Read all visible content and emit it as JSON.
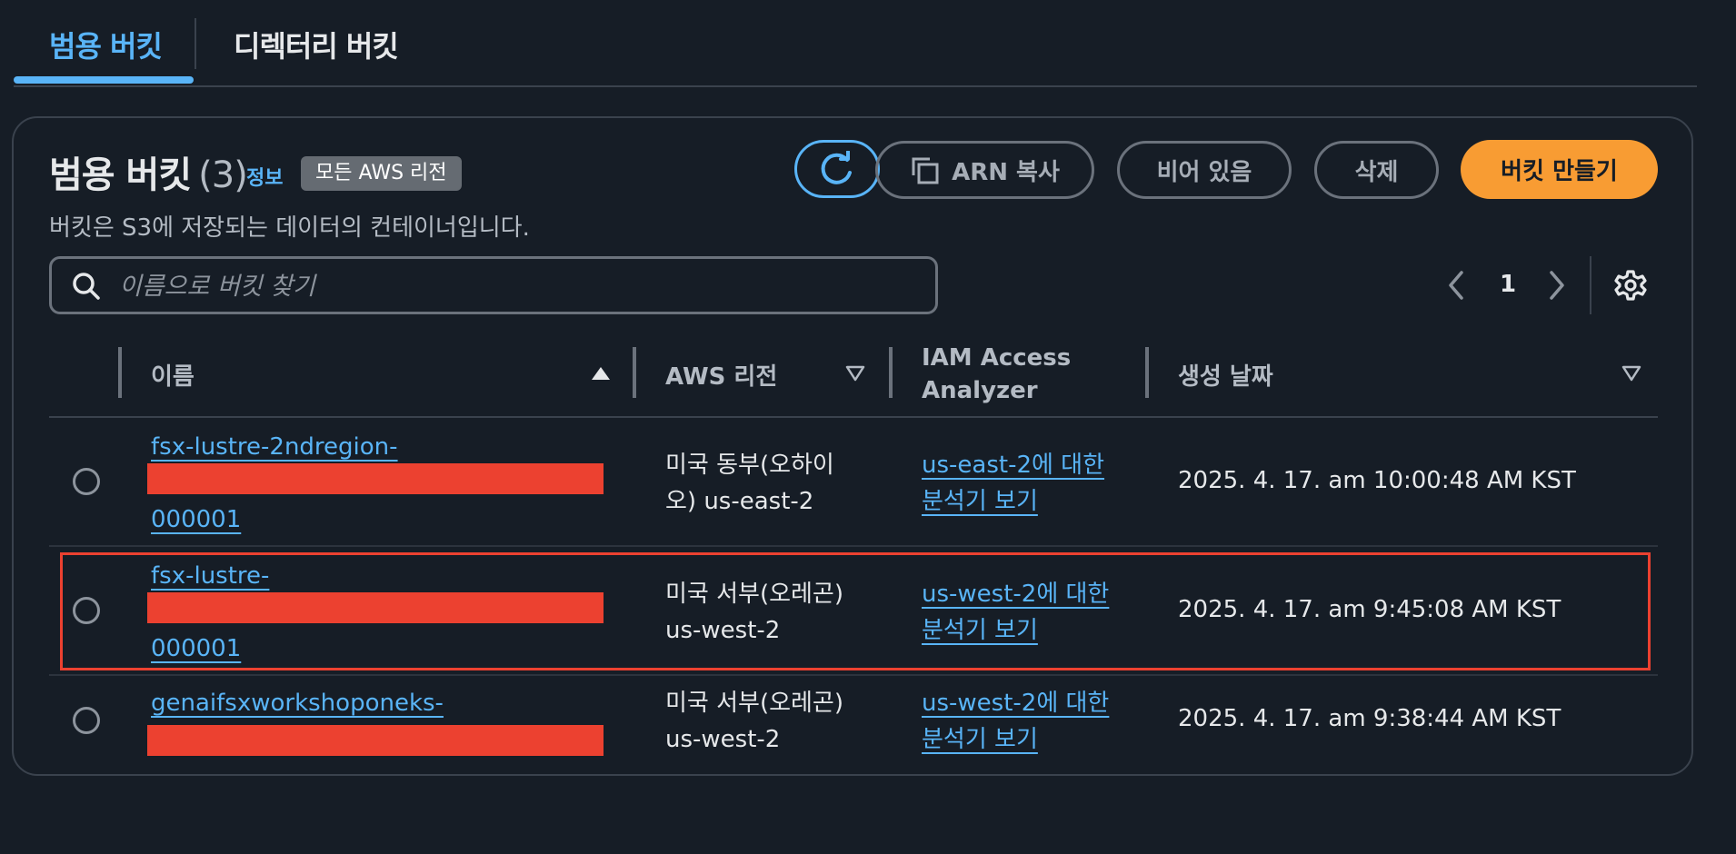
{
  "tabs": [
    {
      "label": "범용 버킷",
      "active": true
    },
    {
      "label": "디렉터리 버킷",
      "active": false
    }
  ],
  "header": {
    "title": "범용 버킷",
    "count": "(3)",
    "info_link": "정보",
    "region_badge": "모든 AWS 리전",
    "subtitle": "버킷은 S3에 저장되는 데이터의 컨테이너입니다."
  },
  "toolbar": {
    "refresh_icon": "refresh-icon",
    "copy_arn_label": "ARN 복사",
    "empty_label": "비어 있음",
    "delete_label": "삭제",
    "create_label": "버킷 만들기"
  },
  "search": {
    "placeholder": "이름으로 버킷 찾기",
    "value": ""
  },
  "pagination": {
    "current_page": "1"
  },
  "table": {
    "columns": [
      {
        "label": "이름",
        "sort": "ascending"
      },
      {
        "label": "AWS 리전",
        "sort": "none"
      },
      {
        "label_line1": "IAM Access",
        "label_line2": "Analyzer"
      },
      {
        "label": "생성 날짜",
        "sort": "none"
      }
    ],
    "rows": [
      {
        "name_line1": "fsx-lustre-2ndregion-",
        "name_line3": "000001",
        "region_line1": "미국 동부(오하이",
        "region_line2": "오) us-east-2",
        "iam_line1": "us-east-2에 대한",
        "iam_line2": "분석기 보기",
        "created": "2025. 4. 17. am 10:00:48 AM KST",
        "selected": false
      },
      {
        "name_line1": "fsx-lustre-",
        "name_line3": "000001",
        "region_line1": "미국 서부(오레곤)",
        "region_line2": "us-west-2",
        "iam_line1": "us-west-2에 대한",
        "iam_line2": "분석기 보기",
        "created": "2025. 4. 17. am 9:45:08 AM KST",
        "selected": false
      },
      {
        "name_line1": "genaifsxworkshoponeks-",
        "region_line1": "미국 서부(오레곤)",
        "region_line2": "us-west-2",
        "iam_line1": "us-west-2에 대한",
        "iam_line2": "분석기 보기",
        "created": "2025. 4. 17. am 9:38:44 AM KST",
        "selected": false
      }
    ]
  },
  "colors": {
    "background": "#161d26",
    "link": "#59b4f7",
    "primary_button": "#f89c33",
    "redaction": "#ec4130",
    "highlight_border": "#ec4130"
  }
}
